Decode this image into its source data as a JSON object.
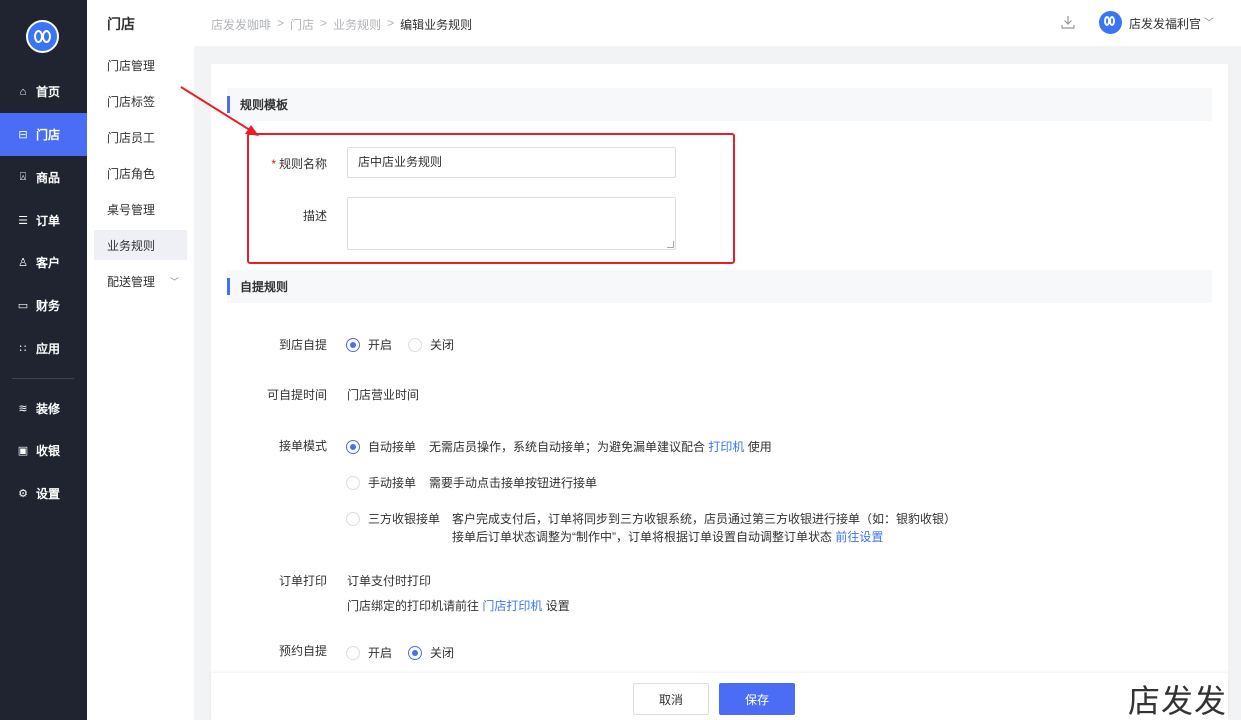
{
  "nav": {
    "items": [
      {
        "icon": "home-icon",
        "glyph": "⌂",
        "label": "首页"
      },
      {
        "icon": "store-icon",
        "glyph": "⊟",
        "label": "门店"
      },
      {
        "icon": "bag-icon",
        "glyph": "⍓",
        "label": "商品"
      },
      {
        "icon": "order-icon",
        "glyph": "☰",
        "label": "订单"
      },
      {
        "icon": "user-icon",
        "glyph": "♙",
        "label": "客户"
      },
      {
        "icon": "wallet-icon",
        "glyph": "▭",
        "label": "财务"
      },
      {
        "icon": "apps-icon",
        "glyph": "∷",
        "label": "应用"
      },
      {
        "icon": "layers-icon",
        "glyph": "≋",
        "label": "装修"
      },
      {
        "icon": "cashier-icon",
        "glyph": "▣",
        "label": "收银"
      },
      {
        "icon": "settings-icon",
        "glyph": "⚙",
        "label": "设置"
      }
    ],
    "active": "门店"
  },
  "submenu": {
    "title": "门店",
    "items": [
      "门店管理",
      "门店标签",
      "门店员工",
      "门店角色",
      "桌号管理",
      "业务规则",
      "配送管理"
    ],
    "active": "业务规则"
  },
  "breadcrumb": {
    "items": [
      "店发发咖啡",
      "门店",
      "业务规则"
    ],
    "separator": ">",
    "current": "编辑业务规则"
  },
  "user": {
    "name": "店发发福利官"
  },
  "sections": {
    "template": "规则模板",
    "pickup": "自提规则"
  },
  "form": {
    "rule_name_label": "规则名称",
    "required_mark": "*",
    "rule_name_value": "店中店业务规则",
    "desc_label": "描述",
    "pickup_label": "到店自提",
    "pickup_on": "开启",
    "pickup_off": "关闭",
    "pickup_time_label": "可自提时间",
    "pickup_time_value": "门店营业时间",
    "accept_mode_label": "接单模式",
    "auto_accept": "自动接单",
    "auto_accept_hint": "无需店员操作，系统自动接单；为避免漏单建议配合",
    "auto_accept_link": "打印机",
    "auto_accept_hint_tail": "使用",
    "manual_accept": "手动接单",
    "manual_accept_hint": "需要手动点击接单按钮进行接单",
    "third_accept": "三方收银接单",
    "third_accept_hint1": "客户完成支付后，订单将同步到三方收银系统，店员通过第三方收银进行接单（如：银豹收银）",
    "third_accept_hint2": "接单后订单状态调整为“制作中”，订单将根据订单设置自动调整订单状态",
    "third_accept_link": "前往设置",
    "print_label": "订单打印",
    "print_value": "订单支付时打印",
    "print_hint": "门店绑定的打印机请前往",
    "print_link": "门店打印机",
    "print_hint_tail": "设置",
    "reserve_label": "预约自提",
    "reserve_on": "开启",
    "reserve_off": "关闭"
  },
  "state": {
    "pickup": "on",
    "accept_mode": "auto",
    "reserve": "off"
  },
  "footer": {
    "cancel": "取消",
    "save": "保存"
  },
  "watermark": "店发发",
  "colors": {
    "accent": "#4b6cf5",
    "nav_bg": "#1f2430",
    "annotation": "#e81f28",
    "link": "#3c74f6"
  }
}
